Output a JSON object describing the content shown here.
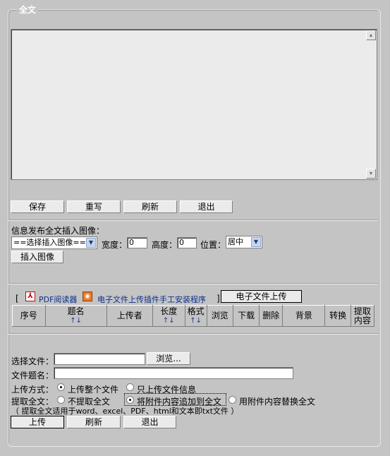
{
  "fieldset": {
    "legend": "全文"
  },
  "fulltext": {
    "value": ""
  },
  "editor_buttons": {
    "save": "保存",
    "reset": "重写",
    "refresh": "刷新",
    "exit": "退出"
  },
  "insert_image": {
    "heading": "信息发布全文插入图像：",
    "select_value": "==选择插入图像==",
    "width_label": "宽度：",
    "width_value": "0",
    "height_label": "高度：",
    "height_value": "0",
    "position_label": "位置：",
    "position_value": "居中",
    "insert_button": "插入图像"
  },
  "links": {
    "open_bracket": "[",
    "pdf_reader": "PDF阅读器",
    "plugin_manual": "电子文件上传插件手工安装程序",
    "close_bracket": "]",
    "upload_button": "电子文件上传"
  },
  "table": {
    "columns": [
      "序号",
      "题名",
      "上传者",
      "长度",
      "格式",
      "浏览",
      "下载",
      "删除",
      "背景",
      "转换",
      "提取内容"
    ],
    "sort_arrows": "↑↓"
  },
  "upload_form": {
    "file_label": "选择文件：",
    "file_value": "",
    "browse_button": "浏览...",
    "title_label": "文件题名：",
    "title_value": "",
    "mode_label": "上传方式：",
    "mode_options": [
      "上传整个文件",
      "只上传文件信息"
    ],
    "mode_selected": "上传整个文件",
    "extract_label": "提取全文：",
    "extract_options": [
      "不提取全文",
      "将附件内容追加到全文",
      "用附件内容替换全文"
    ],
    "extract_selected": "将附件内容追加到全文",
    "note": "（ 提取全文适用于word、excel、PDF、html和文本即txt文件 ）",
    "upload_button": "上传",
    "refresh_button": "刷新",
    "exit_button": "退出"
  },
  "colors": {
    "background": "#c4c4c4",
    "link": "#0b2f8a",
    "legend": "#ffffff"
  }
}
